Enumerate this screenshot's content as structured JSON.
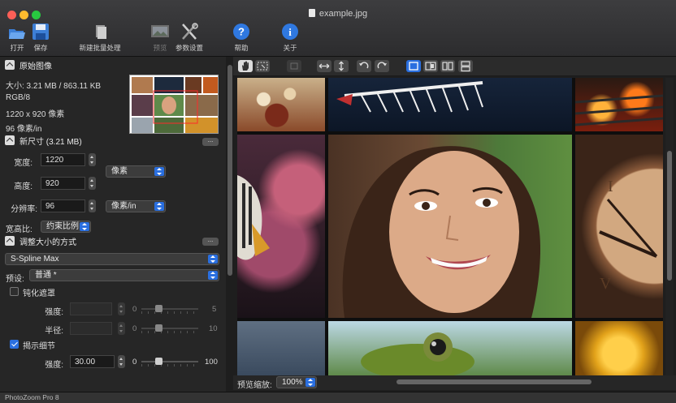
{
  "window": {
    "title": "example.jpg",
    "app_name": "PhotoZoom Pro 8"
  },
  "toolbar": {
    "open": "打开",
    "save": "保存",
    "batch": "新建批量处理",
    "preview": "预览",
    "settings": "参数设置",
    "help": "帮助",
    "about": "关于"
  },
  "original": {
    "header": "原始图像",
    "size": "大小: 3.21 MB / 863.11 KB",
    "mode": "RGB/8",
    "dimensions": "1220 x 920 像素",
    "resolution": "96 像素/in",
    "more": "..."
  },
  "new_size": {
    "header": "新尺寸 (3.21 MB)",
    "more": "...",
    "width_label": "宽度:",
    "width_value": "1220",
    "height_label": "高度:",
    "height_value": "920",
    "unit": "像素",
    "res_label": "分辨率:",
    "res_value": "96",
    "res_unit": "像素/in",
    "aspect_label": "宽高比:",
    "aspect_value": "约束比例"
  },
  "resize_method": {
    "header": "调整大小的方式",
    "more": "...",
    "method": "S-Spline Max",
    "preset_label": "预设:",
    "preset_value": "普通 *"
  },
  "unsharp": {
    "label": "钝化遮罩",
    "checked": false,
    "strength_label": "强度:",
    "strength_min": "0",
    "strength_max": "5",
    "strength_level": 0.3,
    "radius_label": "半径:",
    "radius_min": "0",
    "radius_max": "10",
    "radius_level": 0.3
  },
  "detail": {
    "label": "揭示细节",
    "checked": true,
    "strength_label": "强度:",
    "strength_value": "30.00",
    "min": "0",
    "max": "100",
    "level": 0.3
  },
  "preview": {
    "zoom_label": "预览缩放:",
    "zoom_value": "100%"
  },
  "colors": {
    "accent": "#2a6fe0",
    "panel": "#262626",
    "toolbar": "#333336"
  }
}
